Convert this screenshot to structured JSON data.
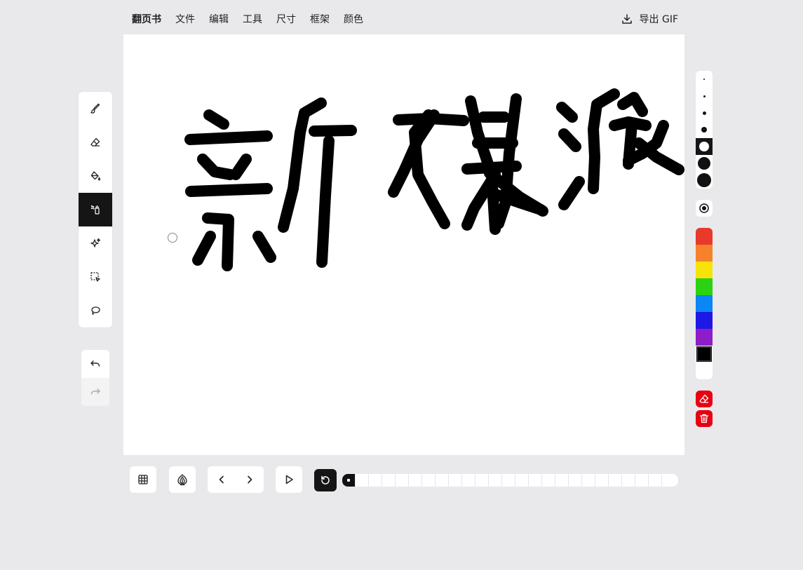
{
  "menu": {
    "brand": "翻页书",
    "items": [
      "文件",
      "编辑",
      "工具",
      "尺寸",
      "框架",
      "颜色"
    ],
    "export_label": "导出 GIF"
  },
  "tools": [
    {
      "name": "brush-icon",
      "active": false
    },
    {
      "name": "eraser-icon",
      "active": false
    },
    {
      "name": "paint-bucket-icon",
      "active": false
    },
    {
      "name": "spray-can-icon",
      "active": true
    },
    {
      "name": "sparkle-icon",
      "active": false
    },
    {
      "name": "select-icon",
      "active": false
    },
    {
      "name": "lasso-icon",
      "active": false
    }
  ],
  "history": {
    "undo": "undo-icon",
    "redo": "redo-icon",
    "redo_enabled": false
  },
  "brush_sizes": {
    "count": 7,
    "active_index": 4
  },
  "colors": [
    "#e8392b",
    "#f5822a",
    "#f7e30a",
    "#2bd312",
    "#0a86f5",
    "#1d18e6",
    "#8e1cc8",
    "#000000",
    "#ffffff"
  ],
  "selected_color": "#000000",
  "actions": {
    "clear_frame": "eraser-icon",
    "delete_frame": "trash-icon",
    "accent": "#e60012"
  },
  "timeline": {
    "frame_count": 24,
    "current_frame": 1
  }
}
